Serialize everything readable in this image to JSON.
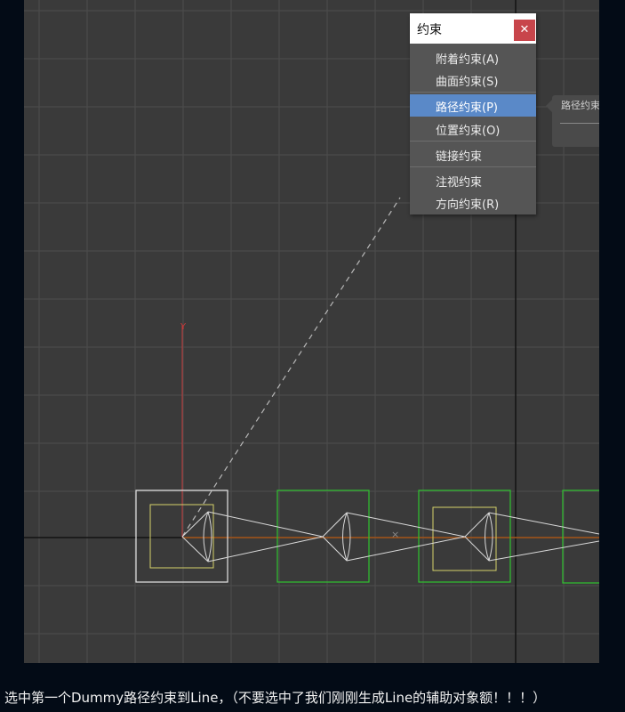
{
  "viewport": {
    "axis_label": "Y",
    "center_mark": "×",
    "colors": {
      "background": "#3a3a3a",
      "grid": "#4d4d4d",
      "axis": "#121212",
      "selected_box": "#e6e6e6",
      "dummy_box": "#2fc22f",
      "inner_box": "#d6d26a",
      "y_axis": "#c43a3a",
      "path_line": "#c8661e",
      "dashed_line": "#b8b8b8"
    }
  },
  "menu": {
    "title": "约束",
    "close_icon": "close-icon",
    "items": [
      {
        "label": "附着约束(A)",
        "active": false
      },
      {
        "label": "曲面约束(S)",
        "active": false
      },
      {
        "label": "路径约束(P)",
        "active": true
      },
      {
        "label": "位置约束(O)",
        "active": false
      },
      {
        "label": "链接约束",
        "active": false
      },
      {
        "label": "注视约束",
        "active": false
      },
      {
        "label": "方向约束(R)",
        "active": false
      }
    ]
  },
  "tooltip": {
    "text": "路径约束"
  },
  "caption": "选中第一个Dummy路径约束到Line，（不要选中了我们刚刚生成Line的辅助对象额！！！）"
}
